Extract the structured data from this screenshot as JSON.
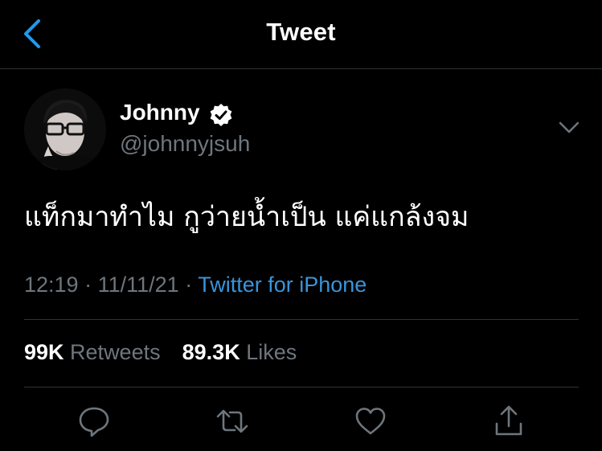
{
  "header": {
    "title": "Tweet"
  },
  "tweet": {
    "author_name": "Johnny",
    "handle": "@johnnyjsuh",
    "text": "แท็กมาทำไม กูว่ายน้ำเป็น แค่แกล้งจม",
    "time": "12:19",
    "separator": "·",
    "date": "11/11/21",
    "source": "Twitter for iPhone"
  },
  "stats": {
    "retweets_count": "99K",
    "retweets_label": "Retweets",
    "likes_count": "89.3K",
    "likes_label": "Likes"
  },
  "colors": {
    "background": "#000000",
    "accent": "#1d9bf0",
    "link": "#3b94d9",
    "muted": "#6e767d",
    "divider": "#2f3336"
  },
  "icons": {
    "back": "chevron-left-icon",
    "verified": "verified-badge-icon",
    "more": "chevron-down-icon",
    "reply": "reply-icon",
    "retweet": "retweet-icon",
    "like": "heart-icon",
    "share": "share-icon"
  }
}
